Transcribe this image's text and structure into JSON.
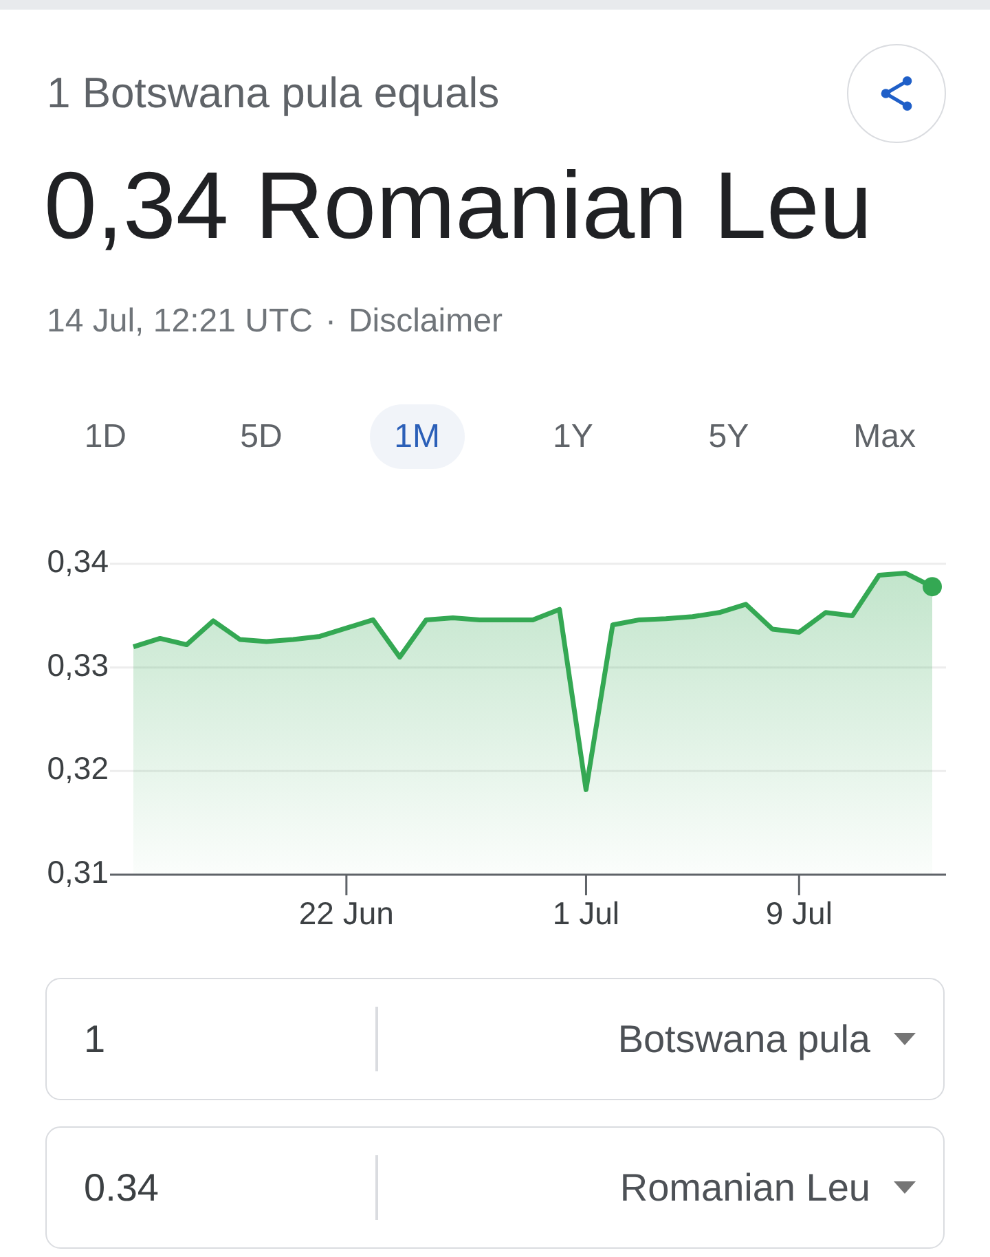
{
  "header": {
    "label": "1 Botswana pula equals",
    "result": "0,34 Romanian Leu"
  },
  "meta": {
    "timestamp": "14 Jul, 12:21 UTC",
    "separator": "·",
    "link": "Disclaimer"
  },
  "range_tabs": [
    {
      "label": "1D",
      "selected": false
    },
    {
      "label": "5D",
      "selected": false
    },
    {
      "label": "1M",
      "selected": true
    },
    {
      "label": "1Y",
      "selected": false
    },
    {
      "label": "5Y",
      "selected": false
    },
    {
      "label": "Max",
      "selected": false
    }
  ],
  "chart": {
    "chart_data": {
      "type": "area",
      "categories": [
        null,
        null,
        null,
        null,
        null,
        null,
        null,
        null,
        "22 Jun",
        null,
        null,
        null,
        null,
        null,
        null,
        null,
        null,
        "1 Jul",
        null,
        null,
        null,
        null,
        null,
        null,
        null,
        "9 Jul",
        null,
        null,
        null,
        null,
        null
      ],
      "series": [
        {
          "color": "#34a853",
          "values": [
            0.332,
            0.3328,
            0.3322,
            0.3345,
            0.3327,
            0.3325,
            0.3327,
            0.333,
            0.3338,
            0.3346,
            0.331,
            0.3346,
            0.3348,
            0.3346,
            0.3346,
            0.3346,
            0.3356,
            0.3182,
            0.3341,
            0.3346,
            0.3347,
            0.3349,
            0.3353,
            0.3361,
            0.3337,
            0.3334,
            0.3353,
            0.335,
            0.3389,
            0.3391,
            0.3378
          ]
        }
      ],
      "ylim": [
        0.31,
        0.34
      ],
      "yticks": [
        {
          "value": 0.34,
          "label": "0,34"
        },
        {
          "value": 0.33,
          "label": "0,33"
        },
        {
          "value": 0.32,
          "label": "0,32"
        },
        {
          "value": 0.31,
          "label": "0,31"
        }
      ]
    }
  },
  "converter": [
    {
      "amount": "1",
      "currency": "Botswana pula"
    },
    {
      "amount": "0.34",
      "currency": "Romanian Leu"
    }
  ]
}
